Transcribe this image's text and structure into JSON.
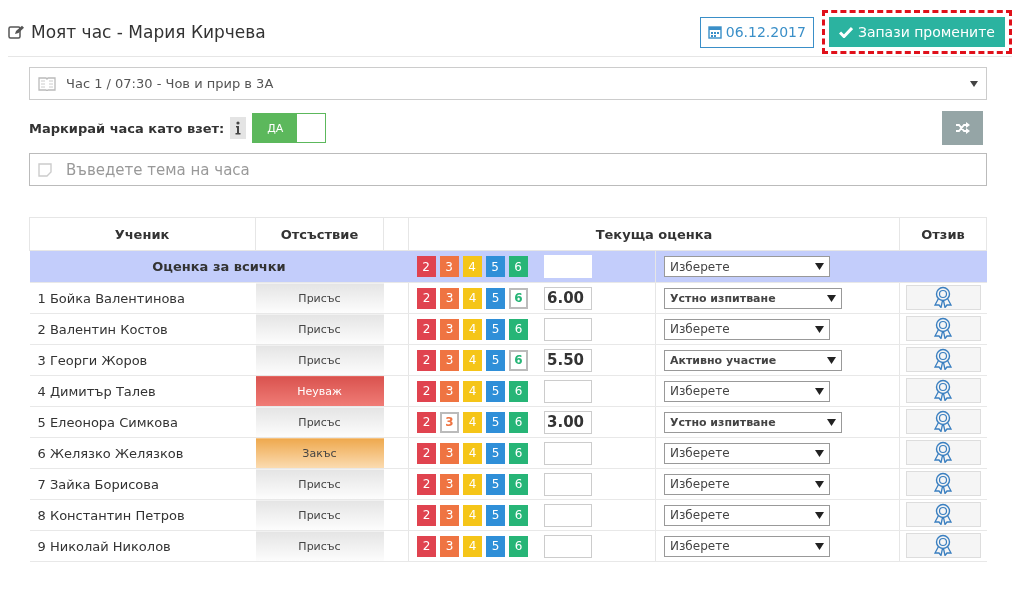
{
  "header": {
    "title": "Моят час - Мария Кирчева",
    "date": "06.12.2017",
    "save_button": "Запази промените"
  },
  "lesson_select": {
    "value": "Час 1 / 07:30 - Чов и прир в 3А"
  },
  "mark_taken": {
    "label": "Маркирай часа като взет:",
    "on": true,
    "toggle_text": "ДА"
  },
  "topic": {
    "placeholder": "Въведете тема на часа"
  },
  "table": {
    "columns": [
      "Ученик",
      "Отсъствие",
      "Текуща оценка",
      "Отзив"
    ],
    "all_row": {
      "label": "Оценка за всички",
      "grades": [
        {
          "label": "2",
          "color": "#e0434f",
          "selected": false
        },
        {
          "label": "3",
          "color": "#ef7442",
          "selected": false
        },
        {
          "label": "4",
          "color": "#f5c518",
          "selected": false
        },
        {
          "label": "5",
          "color": "#2f8fd8",
          "selected": false
        },
        {
          "label": "6",
          "color": "#27b577",
          "selected": false
        }
      ],
      "reason": {
        "value": "Изберете",
        "chosen": false
      }
    },
    "rows": [
      {
        "name": "1 Бойка Валентинова",
        "absence": {
          "label": "Присъс",
          "kind": "present"
        },
        "grades": [
          {
            "label": "2",
            "color": "#e0434f",
            "selected": false
          },
          {
            "label": "3",
            "color": "#ef7442",
            "selected": false
          },
          {
            "label": "4",
            "color": "#f5c518",
            "selected": false
          },
          {
            "label": "5",
            "color": "#2f8fd8",
            "selected": false
          },
          {
            "label": "6",
            "color": "#27b577",
            "selected": true
          }
        ],
        "grade_value": "6.00",
        "reason": {
          "value": "Устно изпитване",
          "chosen": true
        }
      },
      {
        "name": "2 Валентин Костов",
        "absence": {
          "label": "Присъс",
          "kind": "present"
        },
        "grades": [
          {
            "label": "2",
            "color": "#e0434f",
            "selected": false
          },
          {
            "label": "3",
            "color": "#ef7442",
            "selected": false
          },
          {
            "label": "4",
            "color": "#f5c518",
            "selected": false
          },
          {
            "label": "5",
            "color": "#2f8fd8",
            "selected": false
          },
          {
            "label": "6",
            "color": "#27b577",
            "selected": false
          }
        ],
        "reason": {
          "value": "Изберете",
          "chosen": false
        }
      },
      {
        "name": "3 Георги Жоров",
        "absence": {
          "label": "Присъс",
          "kind": "present"
        },
        "grades": [
          {
            "label": "2",
            "color": "#e0434f",
            "selected": false
          },
          {
            "label": "3",
            "color": "#ef7442",
            "selected": false
          },
          {
            "label": "4",
            "color": "#f5c518",
            "selected": false
          },
          {
            "label": "5",
            "color": "#2f8fd8",
            "selected": false
          },
          {
            "label": "6",
            "color": "#27b577",
            "selected": true
          }
        ],
        "grade_value": "5.50",
        "reason": {
          "value": "Активно участие",
          "chosen": true
        }
      },
      {
        "name": "4 Димитър Талев",
        "absence": {
          "label": "Неуваж",
          "kind": "unexcused"
        },
        "grades": [
          {
            "label": "2",
            "color": "#e0434f",
            "selected": false
          },
          {
            "label": "3",
            "color": "#ef7442",
            "selected": false
          },
          {
            "label": "4",
            "color": "#f5c518",
            "selected": false
          },
          {
            "label": "5",
            "color": "#2f8fd8",
            "selected": false
          },
          {
            "label": "6",
            "color": "#27b577",
            "selected": false
          }
        ],
        "reason": {
          "value": "Изберете",
          "chosen": false
        }
      },
      {
        "name": "5 Елеонора Симкова",
        "absence": {
          "label": "Присъс",
          "kind": "present"
        },
        "grades": [
          {
            "label": "2",
            "color": "#e0434f",
            "selected": false
          },
          {
            "label": "3",
            "color": "#ef7442",
            "selected": true
          },
          {
            "label": "4",
            "color": "#f5c518",
            "selected": false
          },
          {
            "label": "5",
            "color": "#2f8fd8",
            "selected": false
          },
          {
            "label": "6",
            "color": "#27b577",
            "selected": false
          }
        ],
        "grade_value": "3.00",
        "reason": {
          "value": "Устно изпитване",
          "chosen": true
        }
      },
      {
        "name": "6 Желязко Желязков",
        "absence": {
          "label": "Закъс",
          "kind": "late"
        },
        "grades": [
          {
            "label": "2",
            "color": "#e0434f",
            "selected": false
          },
          {
            "label": "3",
            "color": "#ef7442",
            "selected": false
          },
          {
            "label": "4",
            "color": "#f5c518",
            "selected": false
          },
          {
            "label": "5",
            "color": "#2f8fd8",
            "selected": false
          },
          {
            "label": "6",
            "color": "#27b577",
            "selected": false
          }
        ],
        "reason": {
          "value": "Изберете",
          "chosen": false
        }
      },
      {
        "name": "7 Зайка Борисова",
        "absence": {
          "label": "Присъс",
          "kind": "present"
        },
        "grades": [
          {
            "label": "2",
            "color": "#e0434f",
            "selected": false
          },
          {
            "label": "3",
            "color": "#ef7442",
            "selected": false
          },
          {
            "label": "4",
            "color": "#f5c518",
            "selected": false
          },
          {
            "label": "5",
            "color": "#2f8fd8",
            "selected": false
          },
          {
            "label": "6",
            "color": "#27b577",
            "selected": false
          }
        ],
        "reason": {
          "value": "Изберете",
          "chosen": false
        }
      },
      {
        "name": "8 Константин Петров",
        "absence": {
          "label": "Присъс",
          "kind": "present"
        },
        "grades": [
          {
            "label": "2",
            "color": "#e0434f",
            "selected": false
          },
          {
            "label": "3",
            "color": "#ef7442",
            "selected": false
          },
          {
            "label": "4",
            "color": "#f5c518",
            "selected": false
          },
          {
            "label": "5",
            "color": "#2f8fd8",
            "selected": false
          },
          {
            "label": "6",
            "color": "#27b577",
            "selected": false
          }
        ],
        "reason": {
          "value": "Изберете",
          "chosen": false
        }
      },
      {
        "name": "9 Николай Николов",
        "absence": {
          "label": "Присъс",
          "kind": "present"
        },
        "grades": [
          {
            "label": "2",
            "color": "#e0434f",
            "selected": false
          },
          {
            "label": "3",
            "color": "#ef7442",
            "selected": false
          },
          {
            "label": "4",
            "color": "#f5c518",
            "selected": false
          },
          {
            "label": "5",
            "color": "#2f8fd8",
            "selected": false
          },
          {
            "label": "6",
            "color": "#27b577",
            "selected": false
          }
        ],
        "reason": {
          "value": "Изберете",
          "chosen": false
        }
      }
    ]
  }
}
